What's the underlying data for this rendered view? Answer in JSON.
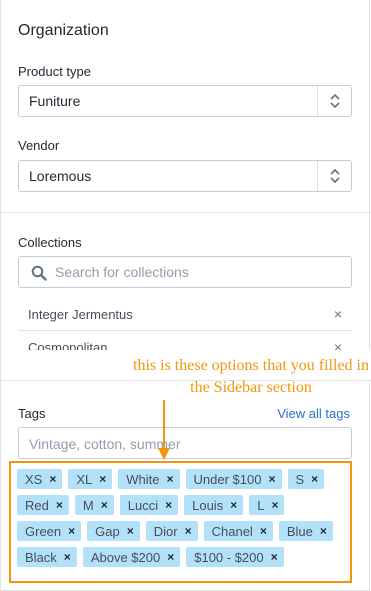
{
  "organization": {
    "title": "Organization",
    "product_type": {
      "label": "Product type",
      "value": "Funiture"
    },
    "vendor": {
      "label": "Vendor",
      "value": "Loremous"
    }
  },
  "collections": {
    "label": "Collections",
    "search_placeholder": "Search for collections",
    "items": [
      {
        "name": "Integer Jermentus",
        "remove": "×"
      },
      {
        "name": "Cosmopolitan",
        "remove": "×"
      }
    ]
  },
  "annotation": {
    "line1": "this is these options that you filled in",
    "line2": "the Sidebar section",
    "color": "#f2950e"
  },
  "tags": {
    "label": "Tags",
    "view_all": "View all tags",
    "placeholder": "Vintage, cotton, summer",
    "remove_glyph": "×",
    "rows": [
      [
        "XS",
        "XL",
        "White",
        "Under $100",
        "S"
      ],
      [
        "Red",
        "M",
        "Lucci",
        "Louis",
        "L"
      ],
      [
        "Green",
        "Gap",
        "Dior",
        "Chanel",
        "Blue"
      ],
      [
        "Black",
        "Above $200",
        "$100 - $200"
      ]
    ],
    "tag_color": "#b4e1fa"
  }
}
